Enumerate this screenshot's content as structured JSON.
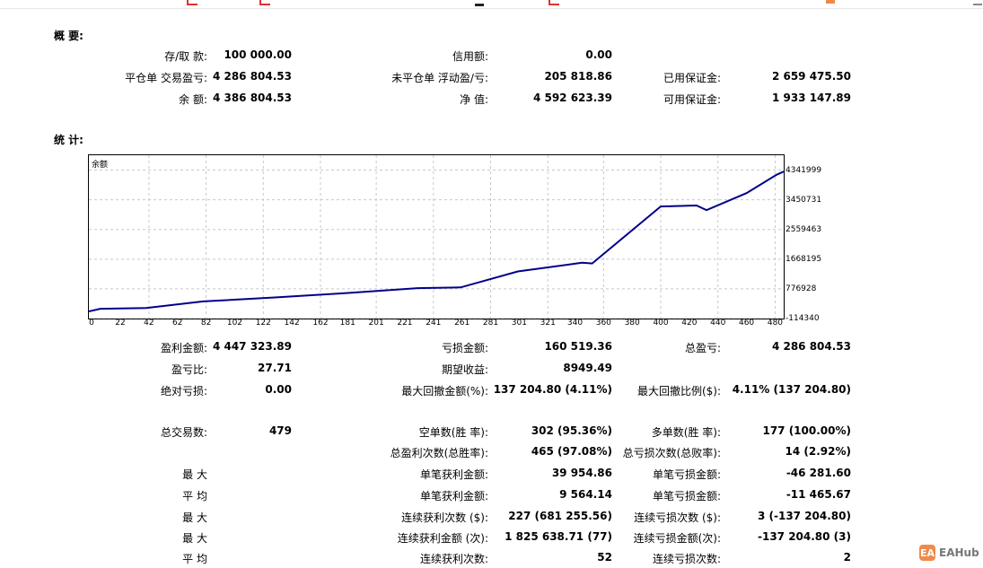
{
  "summary": {
    "title": "概 要:",
    "rows": [
      [
        {
          "label": "存/取 款:",
          "value": "100 000.00"
        },
        {
          "label": "信用额:",
          "value": "0.00"
        },
        {
          "label": "",
          "value": ""
        }
      ],
      [
        {
          "label": "平仓单 交易盈亏:",
          "value": "4 286 804.53"
        },
        {
          "label": "未平仓单 浮动盈/亏:",
          "value": "205 818.86"
        },
        {
          "label": "已用保证金:",
          "value": "2 659 475.50"
        }
      ],
      [
        {
          "label": "余 额:",
          "value": "4 386 804.53"
        },
        {
          "label": "净 值:",
          "value": "4 592 623.39"
        },
        {
          "label": "可用保证金:",
          "value": "1 933 147.89"
        }
      ]
    ]
  },
  "stats": {
    "title": "统 计:",
    "rows": [
      [
        {
          "label": "盈利金额:",
          "value": "4 447 323.89"
        },
        {
          "label": "亏损金额:",
          "value": "160 519.36"
        },
        {
          "label": "总盈亏:",
          "value": "4 286 804.53"
        }
      ],
      [
        {
          "label": "盈亏比:",
          "value": "27.71"
        },
        {
          "label": "期望收益:",
          "value": "8949.49"
        },
        {
          "label": "",
          "value": ""
        }
      ],
      [
        {
          "label": "绝对亏损:",
          "value": "0.00"
        },
        {
          "label": "最大回撤金额(%):",
          "value": "137 204.80 (4.11%)"
        },
        {
          "label": "最大回撤比例($):",
          "value": "4.11% (137 204.80)"
        }
      ],
      [
        {
          "label": "总交易数:",
          "value": "479"
        },
        {
          "label": "空单数(胜 率):",
          "value": "302 (95.36%)"
        },
        {
          "label": "多单数(胜 率):",
          "value": "177 (100.00%)"
        }
      ],
      [
        {
          "label": "",
          "value": ""
        },
        {
          "label": "总盈利次数(总胜率):",
          "value": "465 (97.08%)"
        },
        {
          "label": "总亏损次数(总败率):",
          "value": "14 (2.92%)"
        }
      ],
      [
        {
          "label": "最 大",
          "value": ""
        },
        {
          "label": "单笔获利金额:",
          "value": "39 954.86"
        },
        {
          "label": "单笔亏损金额:",
          "value": "-46 281.60"
        }
      ],
      [
        {
          "label": "平 均",
          "value": ""
        },
        {
          "label": "单笔获利金额:",
          "value": "9 564.14"
        },
        {
          "label": "单笔亏损金额:",
          "value": "-11 465.67"
        }
      ],
      [
        {
          "label": "最 大",
          "value": ""
        },
        {
          "label": "连续获利次数 ($):",
          "value": "227 (681 255.56)"
        },
        {
          "label": "连续亏损次数 ($):",
          "value": "3 (-137 204.80)"
        }
      ],
      [
        {
          "label": "最 大",
          "value": ""
        },
        {
          "label": "连续获利金额 (次):",
          "value": "1 825 638.71 (77)"
        },
        {
          "label": "连续亏损金额(次):",
          "value": "-137 204.80 (3)"
        }
      ],
      [
        {
          "label": "平 均",
          "value": ""
        },
        {
          "label": "连续获利次数:",
          "value": "52"
        },
        {
          "label": "连续亏损次数:",
          "value": "2"
        }
      ]
    ]
  },
  "chart_data": {
    "type": "line",
    "title": "余额",
    "series": [
      {
        "name": "余额",
        "color": "#00008b",
        "x": [
          0,
          8,
          40,
          80,
          130,
          180,
          230,
          260,
          300,
          345,
          352,
          400,
          425,
          432,
          460,
          481,
          486
        ],
        "y": [
          100000,
          180000,
          200000,
          400000,
          520000,
          650000,
          800000,
          820000,
          1300000,
          1560000,
          1540000,
          3250000,
          3280000,
          3140000,
          3650000,
          4200000,
          4300000
        ]
      }
    ],
    "xticks": [
      0,
      22,
      42,
      62,
      82,
      102,
      122,
      142,
      162,
      181,
      201,
      221,
      241,
      261,
      281,
      301,
      321,
      340,
      360,
      380,
      400,
      420,
      440,
      460,
      480
    ],
    "yticks": [
      4341999,
      3450731,
      2559463,
      1668195,
      776928,
      -114340
    ],
    "xlim": [
      0,
      486
    ],
    "ylim": [
      -114340,
      4788000
    ],
    "grid": true
  },
  "watermark": {
    "logo": "EA",
    "text": "EAHub"
  }
}
